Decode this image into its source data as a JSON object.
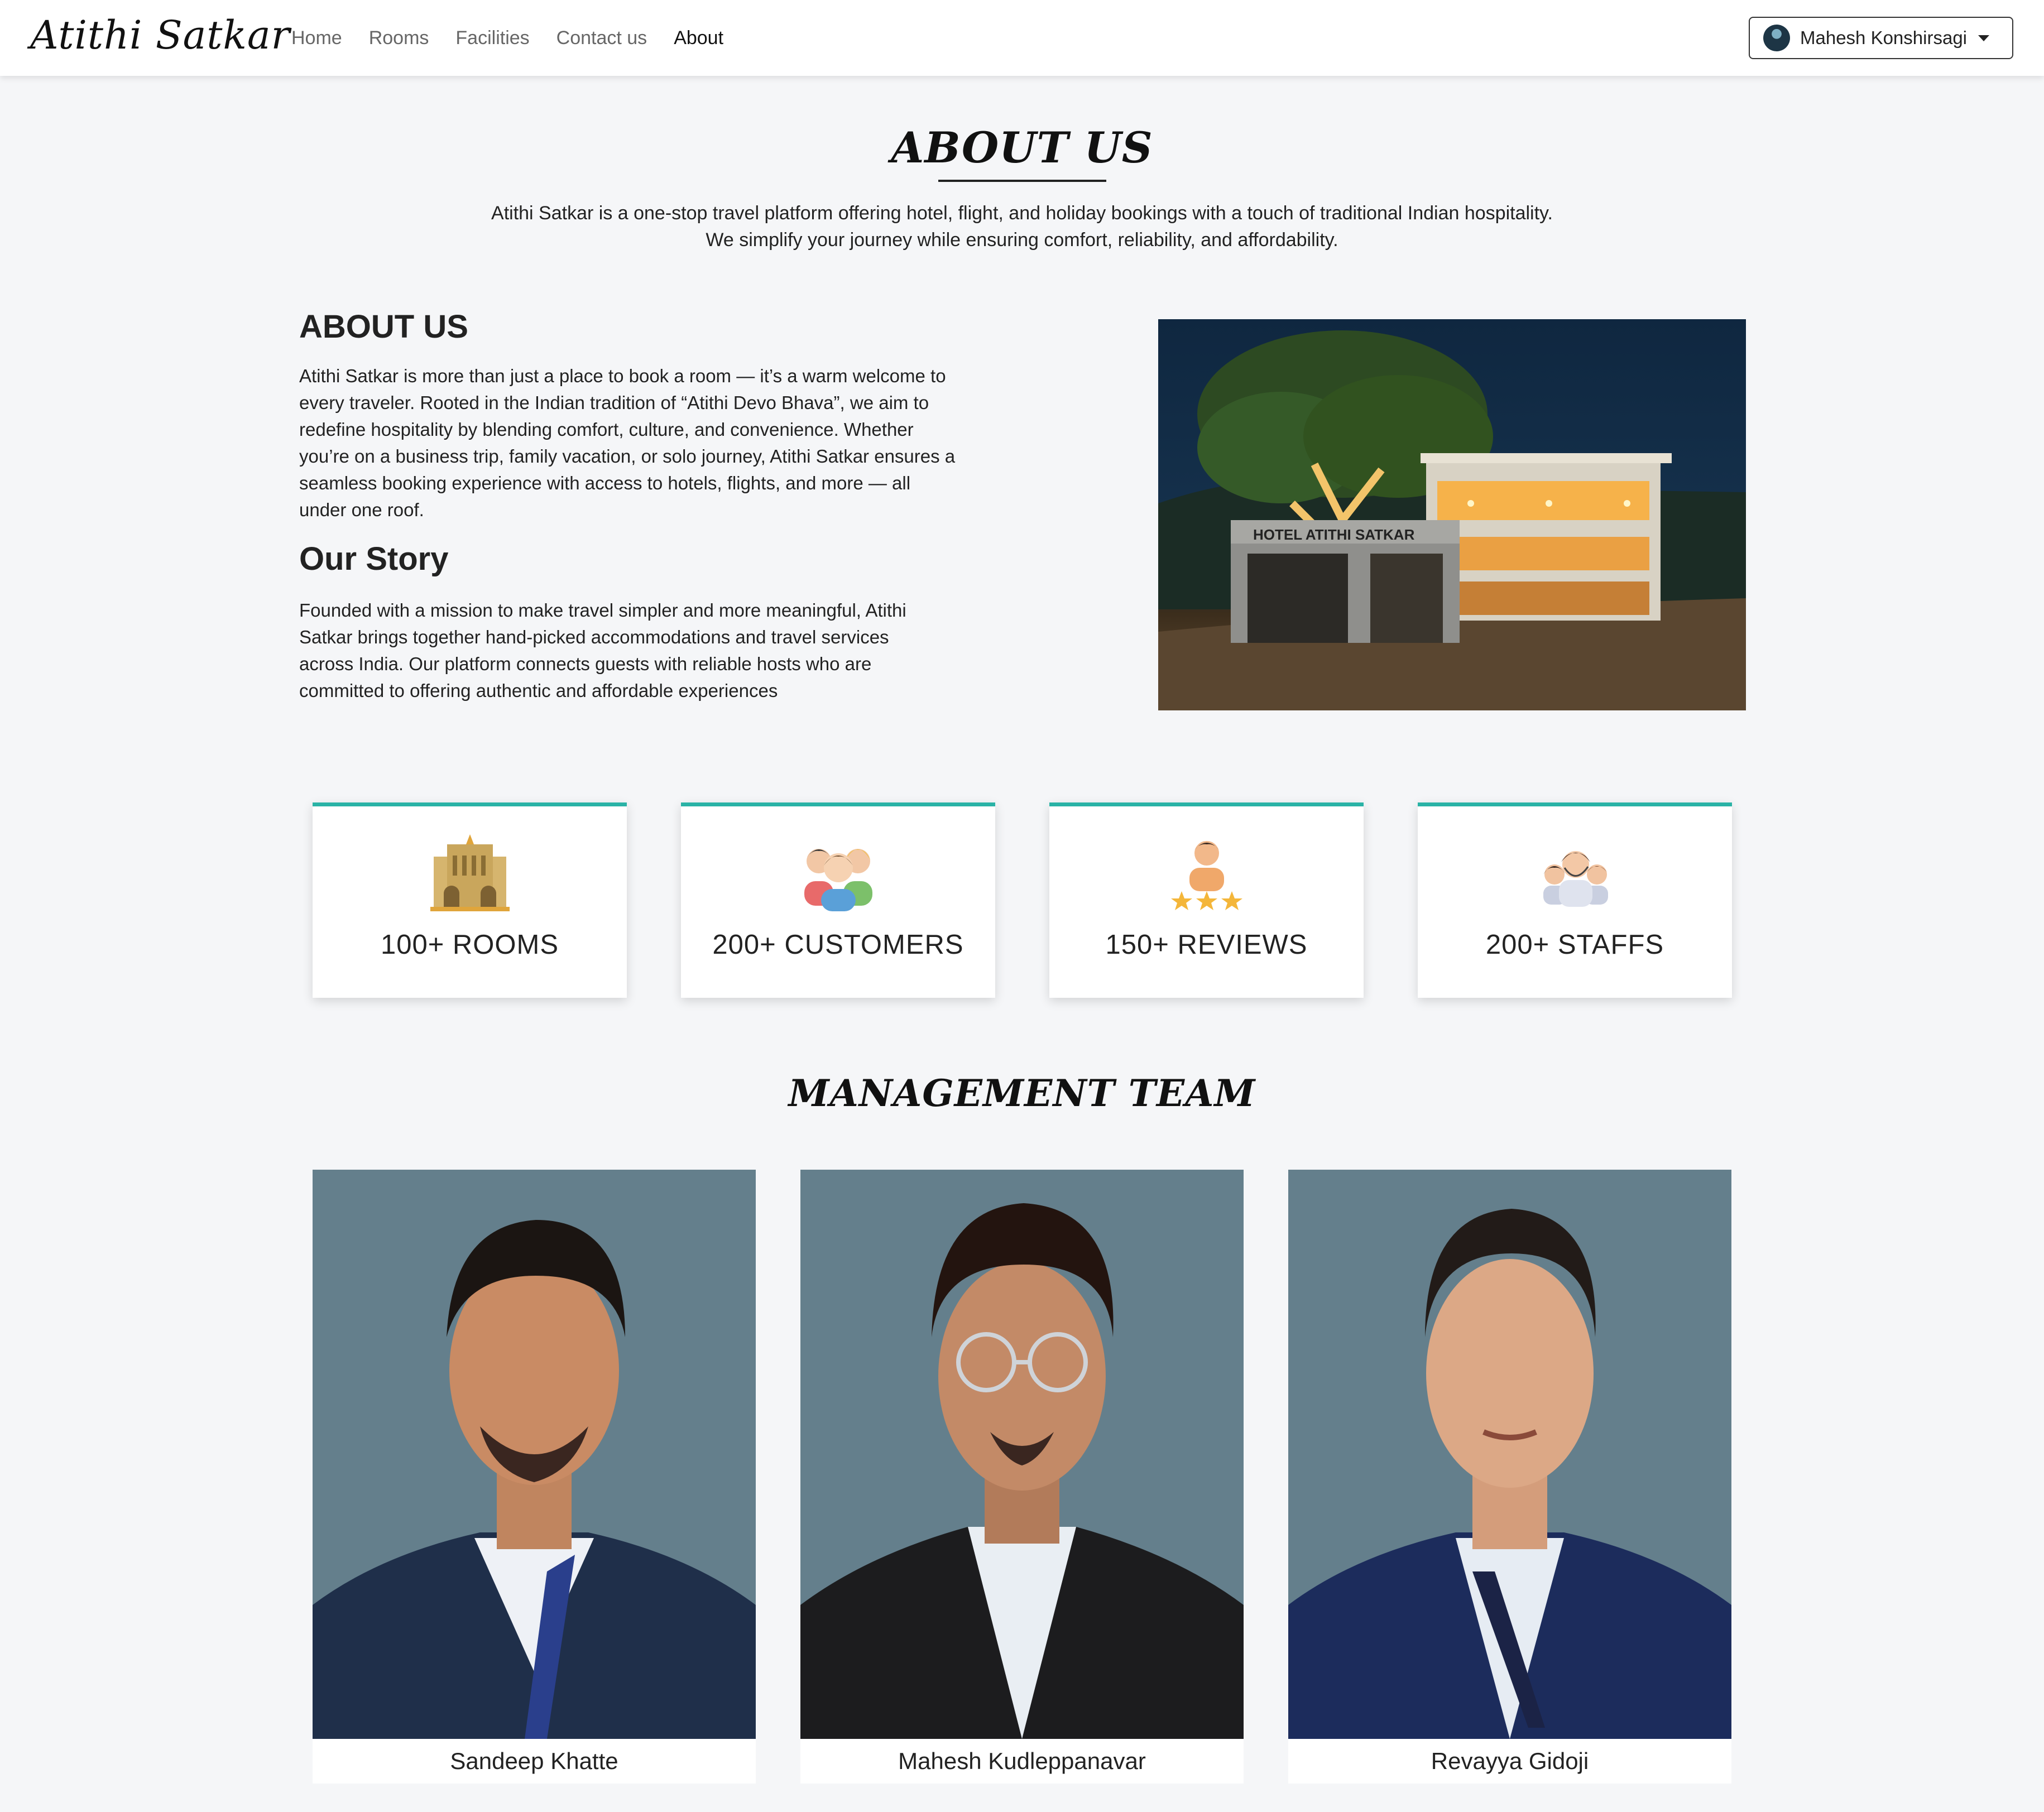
{
  "navbar": {
    "brand": "Atithi Satkar",
    "links": [
      {
        "label": "Home"
      },
      {
        "label": "Rooms"
      },
      {
        "label": "Facilities"
      },
      {
        "label": "Contact us"
      },
      {
        "label": "About",
        "active": true
      }
    ],
    "user": {
      "name": "Mahesh Konshirsagi",
      "icon": "caret-down-icon"
    }
  },
  "hero": {
    "title": "ABOUT US",
    "intro_line1": "Atithi Satkar is a one-stop travel platform offering hotel, flight, and holiday bookings with a touch of traditional Indian hospitality.",
    "intro_line2": "We simplify your journey while ensuring comfort, reliability, and affordability."
  },
  "about": {
    "heading": "ABOUT US",
    "paragraph_lines": [
      "Atithi Satkar is more than just a place to book a room — it’s a warm welcome to",
      "every traveler. Rooted in the Indian tradition of “Atithi Devo Bhava”, we aim to",
      "redefine hospitality by blending comfort, culture, and convenience. Whether",
      "you’re on a business trip, family vacation, or solo journey, Atithi Satkar ensures a",
      "seamless booking experience with access to hotels, flights, and more — all",
      "under one roof."
    ],
    "story_heading": "Our Story",
    "story_lines": [
      "Founded with a mission to make travel simpler and more meaningful, Atithi",
      "Satkar brings together hand-picked accommodations and travel services",
      "across India. Our platform connects guests with reliable hosts who are",
      "committed to offering authentic and affordable experiences"
    ],
    "hotel_sign": "HOTEL ATITHI SATKAR"
  },
  "stats": [
    {
      "label": "100+ ROOMS",
      "icon": "hotel-building-icon"
    },
    {
      "label": "200+ CUSTOMERS",
      "icon": "customers-group-icon"
    },
    {
      "label": "150+ REVIEWS",
      "icon": "reviews-stars-icon"
    },
    {
      "label": "200+ STAFFS",
      "icon": "staff-team-icon"
    }
  ],
  "team": {
    "title": "MANAGEMENT TEAM",
    "members": [
      {
        "name": "Sandeep Khatte"
      },
      {
        "name": "Mahesh Kudleppanavar"
      },
      {
        "name": "Revayya Gidoji"
      }
    ]
  },
  "colors": {
    "accent": "#2ab3a6",
    "page_bg": "#f5f6f8",
    "photo_bg": "#647f8c"
  }
}
